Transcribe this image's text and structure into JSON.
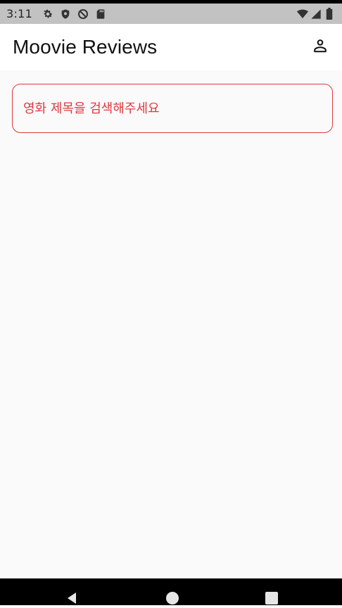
{
  "status_bar": {
    "time": "3:11",
    "left_icons": [
      "gear-icon",
      "shield-icon",
      "do-not-disturb-icon",
      "sd-card-icon"
    ],
    "right_icons": [
      "wifi-icon",
      "cell-signal-icon",
      "battery-icon"
    ]
  },
  "app_bar": {
    "title": "Moovie Reviews",
    "profile_icon": "person-icon"
  },
  "search": {
    "placeholder": "영화 제목을 검색해주세요",
    "value": ""
  },
  "nav_bar": {
    "buttons": [
      "back-icon",
      "home-icon",
      "recents-icon"
    ]
  },
  "colors": {
    "accent": "#e0383f",
    "status_bar": "#c2c2c2",
    "app_bar": "#ffffff",
    "background": "#fafafa",
    "nav_bar": "#000000"
  }
}
